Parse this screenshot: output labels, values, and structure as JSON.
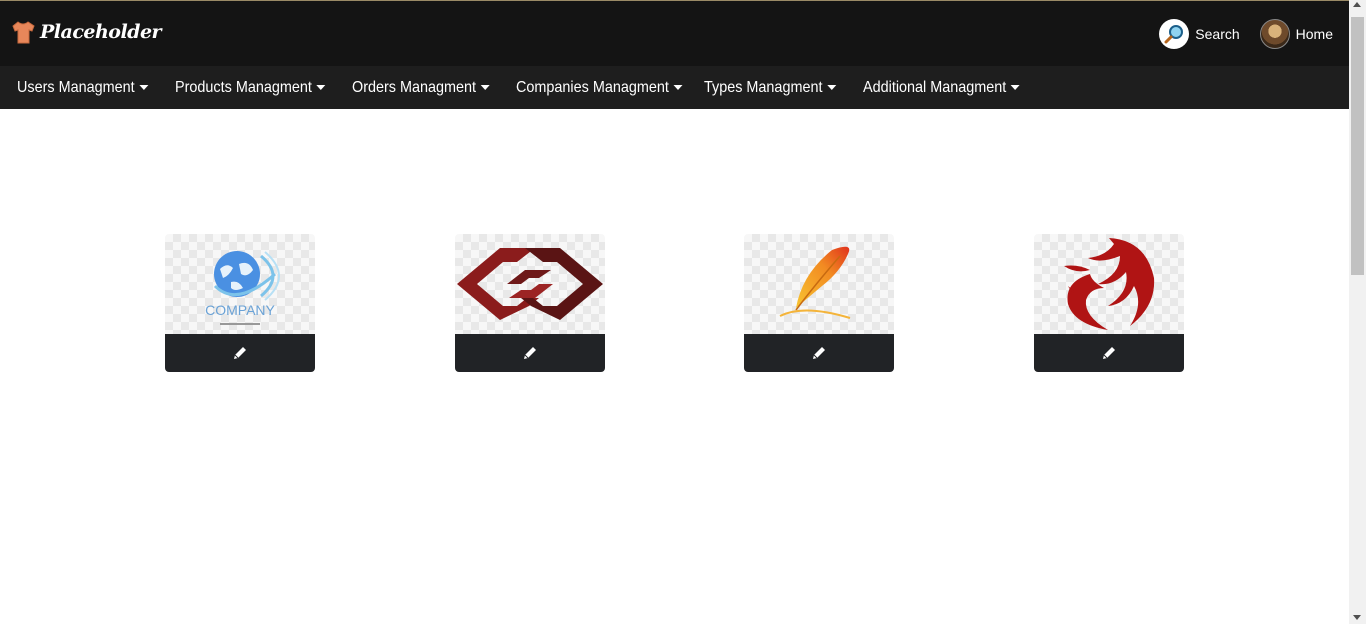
{
  "header": {
    "logo_text": "Placeholder",
    "search_label": "Search",
    "home_label": "Home"
  },
  "nav": {
    "items": [
      {
        "label": "Users Managment"
      },
      {
        "label": "Products Managment"
      },
      {
        "label": "Orders Managment"
      },
      {
        "label": "Companies Managment"
      },
      {
        "label": "Types Managment"
      },
      {
        "label": "Additional Managment"
      }
    ]
  },
  "companies": [
    {
      "logo": "globe-company-logo",
      "logo_text": "COMPANY",
      "action": "edit-pencil-icon"
    },
    {
      "logo": "linked-diamonds-logo",
      "action": "edit-pencil-icon"
    },
    {
      "logo": "feather-quill-logo",
      "action": "edit-pencil-icon"
    },
    {
      "logo": "phoenix-bird-logo",
      "action": "edit-pencil-icon"
    }
  ],
  "colors": {
    "header_bg": "#141414",
    "nav_bg": "#1e1e1e",
    "card_button_bg": "#212326"
  }
}
